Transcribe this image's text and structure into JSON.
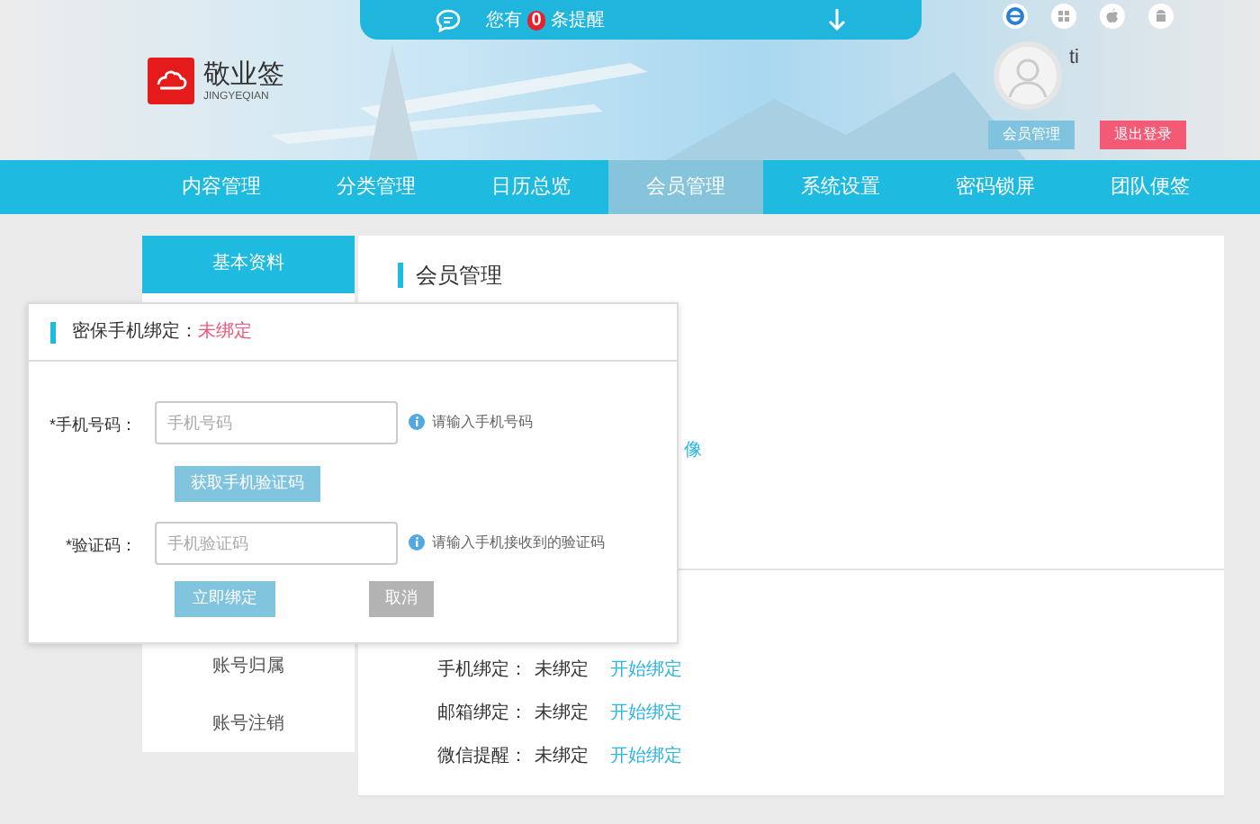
{
  "notice_bar": {
    "prefix": "您有",
    "count": "0",
    "suffix": "条提醒"
  },
  "logo": {
    "name": "敬业签",
    "subtitle": "JINGYEQIAN"
  },
  "user": {
    "name": "ti",
    "buttons": [
      {
        "label": "会员管理",
        "kind": "primary"
      },
      {
        "label": "退出登录",
        "kind": "danger"
      }
    ]
  },
  "nav": [
    {
      "label": "内容管理",
      "selected": false
    },
    {
      "label": "分类管理",
      "selected": false
    },
    {
      "label": "日历总览",
      "selected": false
    },
    {
      "label": "会员管理",
      "selected": true
    },
    {
      "label": "系统设置",
      "selected": false
    },
    {
      "label": "密码锁屏",
      "selected": false
    },
    {
      "label": "团队便签",
      "selected": false
    }
  ],
  "sidebar": {
    "top": [
      {
        "label": "基本资料",
        "selected": true
      }
    ],
    "bottom": [
      {
        "label": "账号归属",
        "selected": false
      },
      {
        "label": "账号注销",
        "selected": false
      }
    ]
  },
  "panel": {
    "title": "会员管理",
    "link_fragment": "像",
    "bindings": [
      {
        "label": "手机绑定：",
        "status": "未绑定",
        "action": "开始绑定"
      },
      {
        "label": "邮箱绑定：",
        "status": "未绑定",
        "action": "开始绑定"
      },
      {
        "label": "微信提醒：",
        "status": "未绑定",
        "action": "开始绑定"
      }
    ]
  },
  "popup": {
    "title": "密保手机绑定：",
    "status": "未绑定",
    "fields": [
      {
        "label": "*手机号码：",
        "placeholder": "手机号码",
        "hint": "请输入手机号码",
        "button": "获取手机验证码"
      },
      {
        "label": "*验证码：",
        "placeholder": "手机验证码",
        "hint": "请输入手机接收到的验证码"
      }
    ],
    "buttons": [
      {
        "label": "立即绑定",
        "kind": "primary"
      },
      {
        "label": "取消",
        "kind": "secondary"
      }
    ]
  }
}
